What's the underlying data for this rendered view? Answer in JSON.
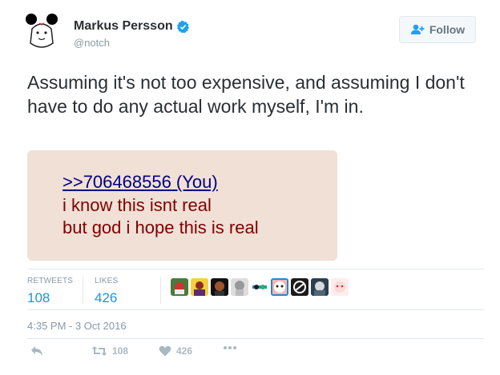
{
  "user": {
    "name": "Markus Persson",
    "handle": "@notch",
    "verified": true
  },
  "follow_button": {
    "label": "Follow",
    "icon": "add-user-icon"
  },
  "tweet": {
    "text": "Assuming it's not too expensive, and assuming I don't have to do any actual work myself, I'm in."
  },
  "quoted_image": {
    "link": ">>706468556 (You)",
    "lines": [
      "i know this isnt real",
      "but god i hope this is real"
    ],
    "background": "#f0e0d6",
    "link_color": "#000080",
    "text_color": "#800000"
  },
  "stats": {
    "retweets_label": "RETWEETS",
    "retweets_value": "108",
    "likes_label": "LIKES",
    "likes_value": "426"
  },
  "liker_avatars": [
    "avatar-1",
    "avatar-2",
    "avatar-3",
    "avatar-4",
    "avatar-5",
    "avatar-6",
    "avatar-7",
    "avatar-8",
    "avatar-9"
  ],
  "timestamp": "4:35 PM - 3 Oct 2016",
  "actions": {
    "reply_icon": "reply-icon",
    "retweet_count": "108",
    "like_count": "426",
    "more_icon": "more-icon"
  },
  "colors": {
    "accent": "#1b95e0",
    "muted": "#8899a6",
    "text": "#292f33"
  }
}
